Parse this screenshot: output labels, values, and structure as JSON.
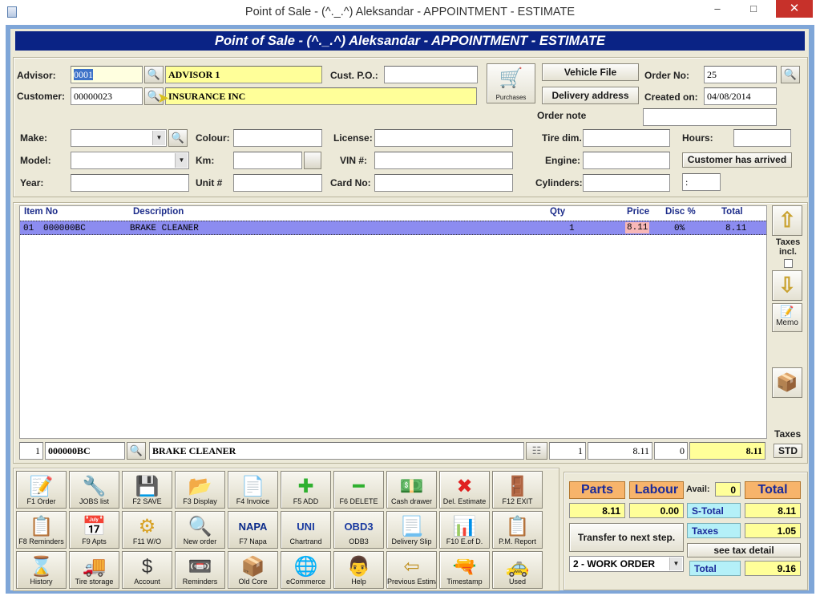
{
  "window": {
    "title": "Point of Sale - (^._.^) Aleksandar - APPOINTMENT - ESTIMATE",
    "minimize": "–",
    "maximize": "□",
    "close": "✕"
  },
  "banner": "Point of Sale - (^._.^) Aleksandar - APPOINTMENT - ESTIMATE",
  "header": {
    "advisor_label": "Advisor:",
    "advisor_code": "0001",
    "advisor_name": "ADVISOR 1",
    "customer_label": "Customer:",
    "customer_code": "00000023",
    "customer_name": "INSURANCE INC",
    "cust_po_label": "Cust. P.O.:",
    "cust_po": "",
    "purchases_label": "Purchases",
    "vehicle_file": "Vehicle File",
    "delivery_address": "Delivery address",
    "order_no_label": "Order No:",
    "order_no": "25",
    "created_on_label": "Created on:",
    "created_on": "04/08/2014",
    "order_note_label": "Order note",
    "order_note": ""
  },
  "vehicle": {
    "make_label": "Make:",
    "model_label": "Model:",
    "year_label": "Year:",
    "colour_label": "Colour:",
    "km_label": "Km:",
    "unit_label": "Unit #",
    "license_label": "License:",
    "vin_label": "VIN #:",
    "card_label": "Card No:",
    "tire_label": "Tire dim.",
    "engine_label": "Engine:",
    "cylinders_label": "Cylinders:",
    "hours_label": "Hours:",
    "arrived_button": "Customer has arrived",
    "time_value": ":"
  },
  "grid": {
    "columns": {
      "item_no": "Item No",
      "description": "Description",
      "qty": "Qty",
      "price": "Price",
      "disc": "Disc %",
      "total": "Total"
    },
    "rows": [
      {
        "line": "01",
        "item": "000000BC",
        "description": "BRAKE CLEANER",
        "qty": "1",
        "price": "8.11",
        "disc": "0%",
        "total": "8.11"
      }
    ],
    "edit": {
      "line": "1",
      "item": "000000BC",
      "description": "BRAKE CLEANER",
      "qty": "1",
      "price": "8.11",
      "disc": "0",
      "total": "8.11"
    }
  },
  "side": {
    "taxes_incl": "Taxes incl.",
    "memo": "Memo",
    "taxes": "Taxes",
    "std": "STD"
  },
  "toolbar": [
    {
      "label": "F1 Order",
      "icon": "📝"
    },
    {
      "label": "JOBS list",
      "icon": "🔧"
    },
    {
      "label": "F2 SAVE",
      "icon": "💾"
    },
    {
      "label": "F3 Display",
      "icon": "📂"
    },
    {
      "label": "F4 Invoice",
      "icon": "📄"
    },
    {
      "label": "F5 ADD",
      "icon": "✚"
    },
    {
      "label": "F6 DELETE",
      "icon": "━"
    },
    {
      "label": "Cash drawer",
      "icon": "💵"
    },
    {
      "label": "Del. Estimate",
      "icon": "✖"
    },
    {
      "label": "F12 EXIT",
      "icon": "🚪"
    },
    {
      "label": "F8 Reminders",
      "icon": "📋"
    },
    {
      "label": "F9 Apts",
      "icon": "📅"
    },
    {
      "label": "F11 W/O",
      "icon": "⚙"
    },
    {
      "label": "New order",
      "icon": "🔍"
    },
    {
      "label": "F7 Napa",
      "icon": "NAPA"
    },
    {
      "label": "Chartrand",
      "icon": "UNI"
    },
    {
      "label": "ODB3",
      "icon": "OBD3"
    },
    {
      "label": "Delivery Slip",
      "icon": "📃"
    },
    {
      "label": "F10 E.of D.",
      "icon": "📊"
    },
    {
      "label": "P.M. Report",
      "icon": "📋"
    },
    {
      "label": "History",
      "icon": "⌛"
    },
    {
      "label": "Tire storage",
      "icon": "🚚"
    },
    {
      "label": "Account",
      "icon": "$"
    },
    {
      "label": "Reminders",
      "icon": "📼"
    },
    {
      "label": "Old Core",
      "icon": "📦"
    },
    {
      "label": "eCommerce",
      "icon": "🌐"
    },
    {
      "label": "Help",
      "icon": "👨"
    },
    {
      "label": "Previous Estimate",
      "icon": "⇦"
    },
    {
      "label": "Timestamp",
      "icon": "🔫"
    },
    {
      "label": "Used",
      "icon": "🚕"
    }
  ],
  "summary": {
    "parts_label": "Parts",
    "labour_label": "Labour",
    "avail_label": "Avail:",
    "avail_value": "0",
    "total_label": "Total",
    "parts_value": "8.11",
    "labour_value": "0.00",
    "stotal_label": "S-Total",
    "stotal_value": "8.11",
    "taxes_label": "Taxes",
    "taxes_value": "1.05",
    "transfer_button": "Transfer to next step.",
    "see_tax_detail": "see tax detail",
    "workflow_value": "2 - WORK ORDER",
    "grand_total_label": "Total",
    "grand_total_value": "9.16"
  },
  "colors": {
    "banner": "#0a2385",
    "selected_row": "#8c8cf0",
    "yellow_field": "#ffff99",
    "orange_header": "#f7b46b",
    "cyan_label": "#b4f0f8"
  }
}
